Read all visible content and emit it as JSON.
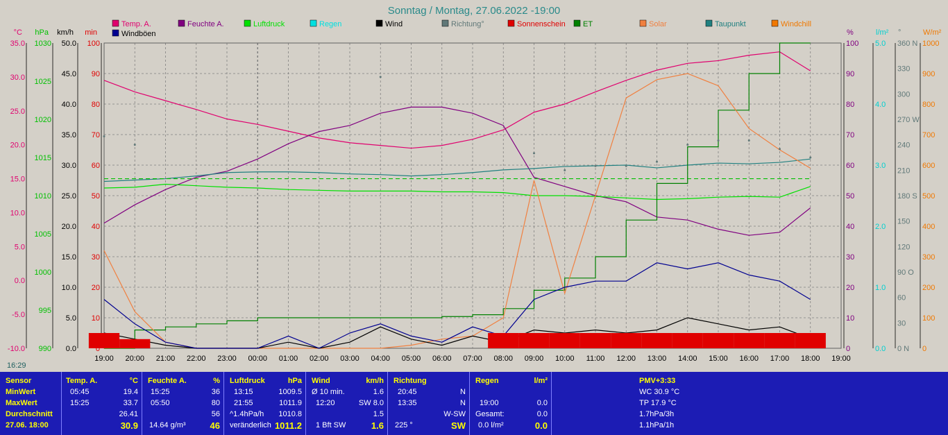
{
  "title": "Sonntag / Montag, 27.06.2022  -19:00",
  "legend": [
    {
      "label": "Temp. A.",
      "color": "#e0006e"
    },
    {
      "label": "Feuchte A.",
      "color": "#800080"
    },
    {
      "label": "Luftdruck",
      "color": "#00e000"
    },
    {
      "label": "Regen",
      "color": "#00e0e0"
    },
    {
      "label": "Wind",
      "color": "#000000"
    },
    {
      "label": "Richtung°",
      "color": "#607878"
    },
    {
      "label": "Sonnenschein",
      "color": "#e00000"
    },
    {
      "label": "ET",
      "color": "#008000"
    },
    {
      "label": "Solar",
      "color": "#f08040"
    },
    {
      "label": "Taupunkt",
      "color": "#208080"
    },
    {
      "label": "Windchill",
      "color": "#f07800"
    },
    {
      "label": "Windböen",
      "color": "#000090"
    }
  ],
  "axes_left": [
    {
      "unit": "°C",
      "color": "#e0006e",
      "ticks": [
        "35.0",
        "30.0",
        "25.0",
        "20.0",
        "15.0",
        "10.0",
        "5.0",
        "0.0",
        "-5.0",
        "-10.0"
      ]
    },
    {
      "unit": "hPa",
      "color": "#00c000",
      "ticks": [
        "1030",
        "1025",
        "1020",
        "1015",
        "1010",
        "1005",
        "1000",
        "995",
        "990"
      ]
    },
    {
      "unit": "km/h",
      "color": "#000000",
      "ticks": [
        "50.0",
        "45.0",
        "40.0",
        "35.0",
        "30.0",
        "25.0",
        "20.0",
        "15.0",
        "10.0",
        "5.0",
        "0.0"
      ]
    },
    {
      "unit": "min",
      "color": "#e00000",
      "ticks": [
        "100",
        "90",
        "80",
        "70",
        "60",
        "50",
        "40",
        "30",
        "20",
        "10",
        "0"
      ]
    }
  ],
  "axes_right": [
    {
      "unit": "%",
      "color": "#800080",
      "ticks": [
        "100",
        "90",
        "80",
        "70",
        "60",
        "50",
        "40",
        "30",
        "20",
        "10",
        "0"
      ]
    },
    {
      "unit": "l/m²",
      "color": "#00d0d0",
      "ticks": [
        "5.0",
        "4.0",
        "3.0",
        "2.0",
        "1.0",
        "0.0"
      ]
    },
    {
      "unit": "°",
      "color": "#607878",
      "ticks": [
        "360 N",
        "330",
        "300",
        "270 W",
        "240",
        "210",
        "180 S",
        "150",
        "120",
        "90 O",
        "60",
        "30",
        "0 N"
      ]
    },
    {
      "unit": "W/m²",
      "color": "#f07800",
      "ticks": [
        "1000",
        "900",
        "800",
        "700",
        "600",
        "500",
        "400",
        "300",
        "200",
        "100",
        "0"
      ]
    }
  ],
  "x_ticks": [
    "19:00",
    "20:00",
    "21:00",
    "22:00",
    "23:00",
    "00:00",
    "01:00",
    "02:00",
    "03:00",
    "04:00",
    "05:00",
    "06:00",
    "07:00",
    "08:00",
    "09:00",
    "10:00",
    "11:00",
    "12:00",
    "13:00",
    "14:00",
    "15:00",
    "16:00",
    "17:00",
    "18:00",
    "19:00"
  ],
  "sunrise_time": "16:29",
  "chart_data": {
    "type": "line",
    "title": "Sonntag / Montag, 27.06.2022  -19:00",
    "x": [
      "19:00",
      "20:00",
      "21:00",
      "22:00",
      "23:00",
      "00:00",
      "01:00",
      "02:00",
      "03:00",
      "04:00",
      "05:00",
      "06:00",
      "07:00",
      "08:00",
      "09:00",
      "10:00",
      "11:00",
      "12:00",
      "13:00",
      "14:00",
      "15:00",
      "16:00",
      "17:00",
      "18:00"
    ],
    "grid": true,
    "series": [
      {
        "name": "Temp. A.",
        "unit": "°C",
        "ylim": [
          -10,
          35
        ],
        "values": [
          29.5,
          27.8,
          26.5,
          25.2,
          23.8,
          23.0,
          22.0,
          21.0,
          20.3,
          19.9,
          19.5,
          19.9,
          20.8,
          22.2,
          24.8,
          26.0,
          27.8,
          29.5,
          31.0,
          32.0,
          32.4,
          33.2,
          33.7,
          30.9
        ]
      },
      {
        "name": "Feuchte A.",
        "unit": "%",
        "ylim": [
          0,
          100
        ],
        "values": [
          41,
          47,
          52,
          56,
          58,
          62,
          67,
          71,
          73,
          77,
          79,
          79,
          77,
          73,
          56,
          53,
          50,
          48,
          43,
          42,
          39,
          37,
          38,
          46
        ]
      },
      {
        "name": "Luftdruck",
        "unit": "hPa",
        "ylim": [
          990,
          1030
        ],
        "values": [
          1011.0,
          1011.1,
          1011.5,
          1011.3,
          1011.1,
          1011.0,
          1010.8,
          1010.7,
          1010.6,
          1010.6,
          1010.6,
          1010.5,
          1010.5,
          1010.4,
          1010.0,
          1010.0,
          1009.9,
          1009.7,
          1009.5,
          1009.6,
          1009.8,
          1009.9,
          1009.8,
          1011.2
        ]
      },
      {
        "name": "Taupunkt",
        "unit": "°C",
        "ylim": [
          -10,
          35
        ],
        "values": [
          14.6,
          14.8,
          15.0,
          15.4,
          15.9,
          16.0,
          16.0,
          15.9,
          15.7,
          15.6,
          15.4,
          15.6,
          15.9,
          16.3,
          16.5,
          16.8,
          16.9,
          17.0,
          16.6,
          17.0,
          17.3,
          17.2,
          17.4,
          17.9
        ]
      },
      {
        "name": "Windchill",
        "unit": "°C",
        "ylim": [
          -10,
          35
        ],
        "values": [
          15.0,
          15.0,
          15.0,
          15.0,
          15.0,
          15.0,
          15.0,
          15.0,
          15.0,
          15.0,
          15.0,
          15.0,
          15.0,
          15.0,
          15.0,
          15.0,
          15.0,
          15.0,
          15.0,
          15.0,
          15.0,
          15.0,
          15.0,
          15.0
        ]
      },
      {
        "name": "ET",
        "unit": "l/m²",
        "ylim": [
          0,
          5
        ],
        "values": [
          0.0,
          0.3,
          0.35,
          0.4,
          0.45,
          0.5,
          0.5,
          0.5,
          0.5,
          0.5,
          0.5,
          0.52,
          0.55,
          0.65,
          0.95,
          1.15,
          1.5,
          2.1,
          2.7,
          3.3,
          3.9,
          4.5,
          5.0,
          5.0
        ]
      },
      {
        "name": "Solar",
        "unit": "W/m²",
        "ylim": [
          0,
          1000
        ],
        "values": [
          320,
          120,
          20,
          0,
          0,
          0,
          0,
          0,
          0,
          0,
          10,
          30,
          40,
          100,
          550,
          180,
          500,
          820,
          880,
          900,
          860,
          720,
          650,
          590
        ]
      },
      {
        "name": "Wind",
        "unit": "km/h",
        "ylim": [
          0,
          50
        ],
        "values": [
          2.5,
          1.5,
          0.5,
          0,
          0,
          0,
          1,
          0,
          1,
          3.5,
          1.5,
          0.5,
          2,
          1,
          3,
          2.5,
          3,
          2.5,
          3,
          5,
          4,
          3,
          3.5,
          1.6
        ]
      },
      {
        "name": "Windböen",
        "unit": "km/h",
        "ylim": [
          0,
          50
        ],
        "values": [
          8,
          4,
          1,
          0,
          0,
          0,
          2,
          0,
          2.5,
          4,
          2,
          1,
          3.5,
          2,
          8,
          10,
          11,
          11,
          14,
          13,
          14,
          12,
          11,
          8
        ]
      },
      {
        "name": "Richtung°",
        "unit": "°",
        "ylim": [
          0,
          360
        ],
        "values": [
          250,
          240,
          0,
          0,
          0,
          0,
          0,
          0,
          0,
          320,
          0,
          0,
          0,
          0,
          230,
          210,
          215,
          215,
          220,
          240,
          245,
          245,
          235,
          225
        ]
      },
      {
        "name": "Sonnenschein",
        "unit": "min",
        "ylim": [
          0,
          100
        ],
        "values": [
          5,
          3,
          0,
          0,
          0,
          0,
          0,
          0,
          0,
          0,
          0,
          0,
          0,
          5,
          5,
          5,
          5,
          5,
          5,
          5,
          5,
          5,
          5,
          5
        ]
      }
    ]
  },
  "info": {
    "sensor": {
      "header": "Sensor",
      "min": "MinWert",
      "max": "MaxWert",
      "avg": "Durchschnitt",
      "date": "27.06. 18:00"
    },
    "temp": {
      "header": "Temp. A.",
      "unit": "°C",
      "min_time": "05:45",
      "min_val": "19.4",
      "max_time": "15:25",
      "max_val": "33.7",
      "avg": "26.41",
      "current": "30.9"
    },
    "humidity": {
      "header": "Feuchte A.",
      "unit": "%",
      "min_time": "15:25",
      "min_val": "36",
      "max_time": "05:50",
      "max_val": "80",
      "avg": "56",
      "abs": "14.64 g/m³",
      "current": "46"
    },
    "pressure": {
      "header": "Luftdruck",
      "unit": "hPa",
      "min_time": "13:15",
      "min_val": "1009.5",
      "max_time": "21:55",
      "max_val": "1011.9",
      "trend": "^1.4hPa/h",
      "avg": "1010.8",
      "trend_text": "veränderlich",
      "current": "1011.2"
    },
    "wind": {
      "header": "Wind",
      "unit": "km/h",
      "avg_label": "Ø 10 min.",
      "avg_val": "1.6",
      "gust_time": "12:20",
      "gust_val": "SW 8.0",
      "avg": "1.5",
      "bft": "1 Bft SW",
      "current": "1.6"
    },
    "direction": {
      "header": "Richtung",
      "min_time": "20:45",
      "min_val": "N",
      "max_time": "13:35",
      "max_val": "N",
      "avg": "W-SW",
      "deg": "225 °",
      "current": "SW"
    },
    "rain": {
      "header": "Regen",
      "unit": "l/m²",
      "time": "19:00",
      "val": "0.0",
      "total_label": "Gesamt:",
      "total_val": "0.0",
      "day": "0.0 l/m²",
      "current": "0.0"
    },
    "pmv": {
      "header": "PMV+3:33",
      "wc": "WC 30.9 °C",
      "tp": "TP 17.9 °C",
      "p3h": "1.7hPa/3h",
      "p1h": "1.1hPa/1h"
    }
  }
}
